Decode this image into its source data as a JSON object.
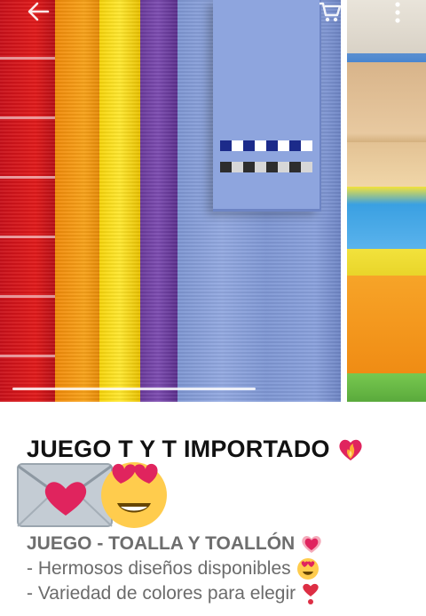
{
  "toolbar": {
    "back_icon": "arrow-back-icon",
    "cart_icon": "shopping-cart-icon",
    "more_icon": "more-vertical-icon"
  },
  "carousel": {
    "images": [
      {
        "description_icon": "towels-photo"
      },
      {
        "description_icon": "folded-towels-photo"
      }
    ],
    "current_index": 0
  },
  "post": {
    "title": "JUEGO T Y T IMPORTADO",
    "title_emoji": "heart-on-fire-emoji",
    "emojis": [
      "envelope-with-heart-emoji",
      "heart-eyes-emoji"
    ],
    "subtitle": "JUEGO - TOALLA Y TOALLÓN",
    "subtitle_emoji": "growing-heart-emoji",
    "lines": [
      {
        "text": "- Hermosos diseños disponibles",
        "emoji": "heart-eyes-emoji"
      },
      {
        "text": "- Variedad de colores para elegir",
        "emoji": "heart-exclamation-emoji"
      }
    ]
  },
  "colors": {
    "title_text": "#111111",
    "body_text": "#6b6b6b",
    "background": "#ffffff"
  }
}
